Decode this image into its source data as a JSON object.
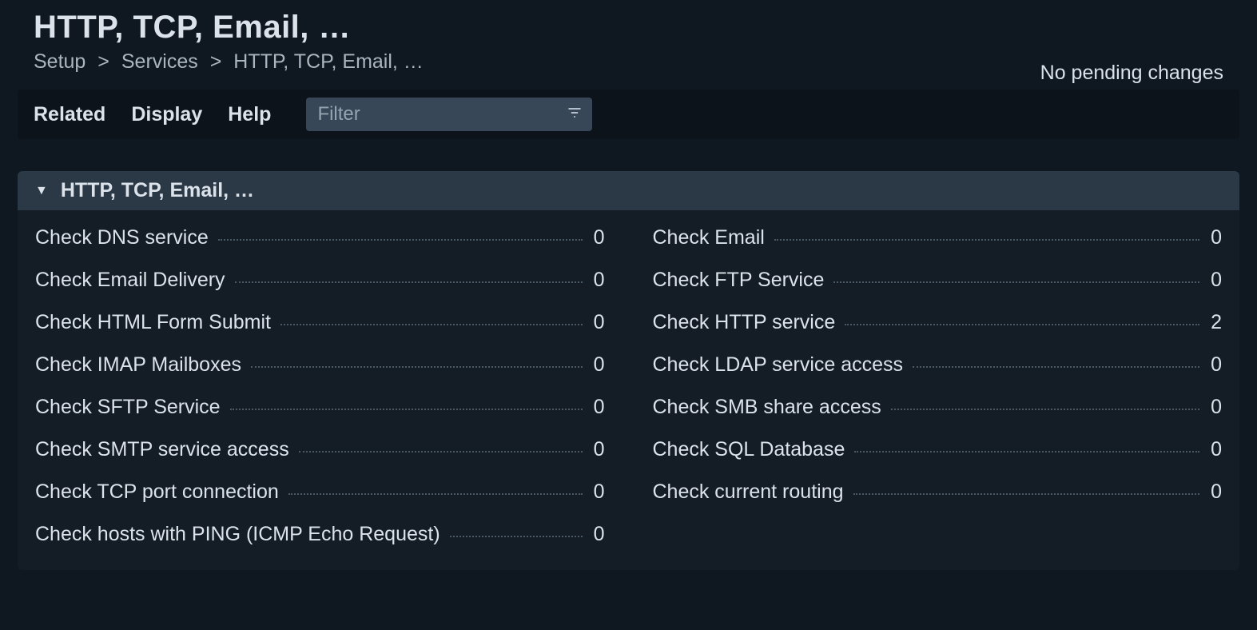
{
  "header": {
    "title": "HTTP, TCP, Email, …",
    "breadcrumb": [
      "Setup",
      "Services",
      "HTTP, TCP, Email, …"
    ],
    "pending_status": "No pending changes"
  },
  "toolbar": {
    "menu": {
      "related": "Related",
      "display": "Display",
      "help": "Help"
    },
    "filter_placeholder": "Filter"
  },
  "section": {
    "title": "HTTP, TCP, Email, …",
    "items": [
      {
        "label": "Check DNS service",
        "count": 0
      },
      {
        "label": "Check Email Delivery",
        "count": 0
      },
      {
        "label": "Check HTML Form Submit",
        "count": 0
      },
      {
        "label": "Check IMAP Mailboxes",
        "count": 0
      },
      {
        "label": "Check SFTP Service",
        "count": 0
      },
      {
        "label": "Check SMTP service access",
        "count": 0
      },
      {
        "label": "Check TCP port connection",
        "count": 0
      },
      {
        "label": "Check hosts with PING (ICMP Echo Request)",
        "count": 0
      },
      {
        "label": "Check Email",
        "count": 0
      },
      {
        "label": "Check FTP Service",
        "count": 0
      },
      {
        "label": "Check HTTP service",
        "count": 2
      },
      {
        "label": "Check LDAP service access",
        "count": 0
      },
      {
        "label": "Check SMB share access",
        "count": 0
      },
      {
        "label": "Check SQL Database",
        "count": 0
      },
      {
        "label": "Check current routing",
        "count": 0
      }
    ]
  }
}
